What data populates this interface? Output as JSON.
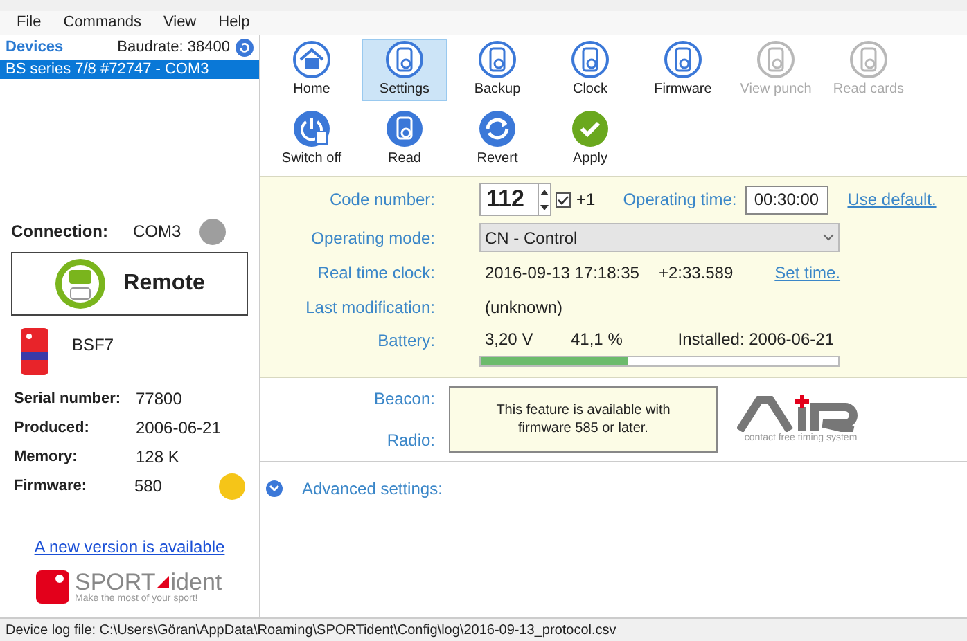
{
  "menu": [
    "File",
    "Commands",
    "View",
    "Help"
  ],
  "devices": {
    "title": "Devices",
    "baudrate": "Baudrate: 38400",
    "items": [
      {
        "label": "BS series 7/8 #72747 - COM3",
        "selected": true
      }
    ]
  },
  "connection": {
    "label": "Connection:",
    "value": "COM3"
  },
  "mode_button": "Remote",
  "device_name": "BSF7",
  "info": [
    {
      "label": "Serial number:",
      "value": "77800",
      "warning": false
    },
    {
      "label": "Produced:",
      "value": "2006-06-21",
      "warning": false
    },
    {
      "label": "Memory:",
      "value": "128 K",
      "warning": false
    },
    {
      "label": "Firmware:",
      "value": "580",
      "warning": true
    }
  ],
  "update_link": "A new version is available",
  "logo": {
    "word1": "SPORT",
    "word2": "ident",
    "tagline": "Make the most of your sport!"
  },
  "toolbar_rows": [
    [
      {
        "label": "Home",
        "kind": "home",
        "selected": false,
        "disabled": false
      },
      {
        "label": "Settings",
        "kind": "device",
        "selected": true,
        "disabled": false
      },
      {
        "label": "Backup",
        "kind": "device",
        "selected": false,
        "disabled": false
      },
      {
        "label": "Clock",
        "kind": "device",
        "selected": false,
        "disabled": false
      },
      {
        "label": "Firmware",
        "kind": "device",
        "selected": false,
        "disabled": false
      },
      {
        "label": "View punch",
        "kind": "device",
        "selected": false,
        "disabled": true
      },
      {
        "label": "Read cards",
        "kind": "device",
        "selected": false,
        "disabled": true
      }
    ],
    [
      {
        "label": "Switch off",
        "kind": "power",
        "selected": false,
        "disabled": false
      },
      {
        "label": "Read",
        "kind": "read",
        "selected": false,
        "disabled": false
      },
      {
        "label": "Revert",
        "kind": "revert",
        "selected": false,
        "disabled": false
      },
      {
        "label": "Apply",
        "kind": "apply",
        "selected": false,
        "disabled": false
      }
    ]
  ],
  "settings": {
    "code_label": "Code number:",
    "code_value": "112",
    "increment_checked": true,
    "increment_label": "+1",
    "operating_time_label": "Operating time:",
    "operating_time_value": "00:30:00",
    "use_default": "Use default.",
    "mode_label": "Operating mode:",
    "mode_value": "CN - Control",
    "clock_label": "Real time clock:",
    "clock_value": "2016-09-13 17:18:35",
    "clock_offset": "+2:33.589",
    "set_time": "Set time.",
    "modification_label": "Last modification:",
    "modification_value": "(unknown)",
    "battery_label": "Battery:",
    "battery_voltage": "3,20 V",
    "battery_percent": "41,1 %",
    "battery_installed": "Installed: 2006-06-21",
    "battery": {
      "level": 0.411
    }
  },
  "air": {
    "beacon_label": "Beacon:",
    "radio_label": "Radio:",
    "notice": "This feature is available with firmware 585 or later.",
    "logo_tagline": "contact free timing system"
  },
  "advanced": {
    "label": "Advanced settings:",
    "expanded": false
  },
  "status_bar": "Device log file: C:\\Users\\Göran\\AppData\\Roaming\\SPORTident\\Config\\log\\2016-09-13_protocol.csv"
}
